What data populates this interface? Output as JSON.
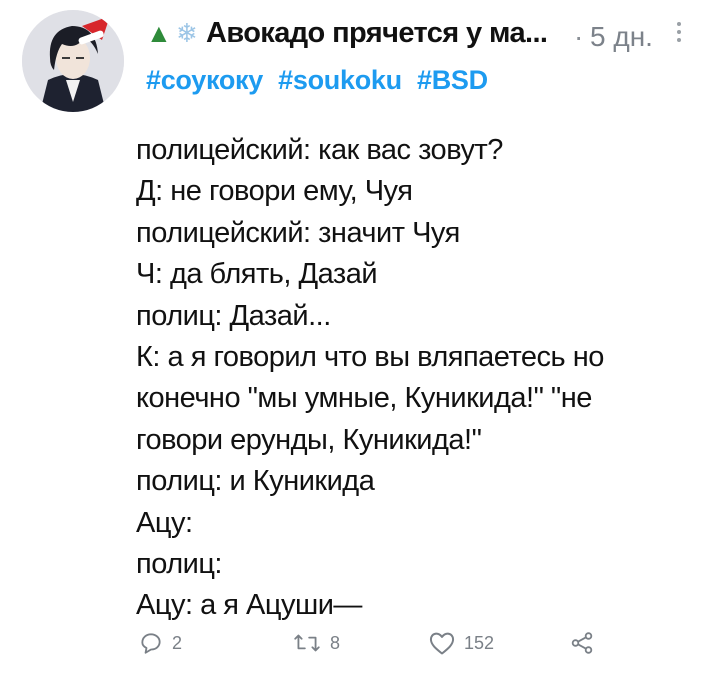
{
  "tweet": {
    "author": {
      "emoji_icons": [
        "christmas-tree-icon",
        "snowflake-icon"
      ],
      "display_name": "Авокадо прячется у ма...",
      "time_separator": "·",
      "time": "5 дн."
    },
    "hashtags": [
      "#соукоку",
      "#soukoku",
      "#BSD"
    ],
    "text_lines": [
      "полицейский: как вас зовут?",
      "Д: не говори ему, Чуя",
      "полицейский: значит Чуя",
      "Ч: да блять, Дазай",
      "полиц: Дазай...",
      "К: а я говорил что вы вляпаетесь но",
      "конечно \"мы умные, Куникида!\" \"не",
      "говори ерунды, Куникида!\"",
      "полиц: и Куникида",
      "Ацу:",
      "полиц:",
      "Ацу: а я Ацуши—"
    ],
    "actions": {
      "reply_count": "2",
      "retweet_count": "8",
      "like_count": "152"
    }
  },
  "colors": {
    "hashtag": "#1d9bf0",
    "muted": "#7a8087",
    "text": "#111111"
  }
}
